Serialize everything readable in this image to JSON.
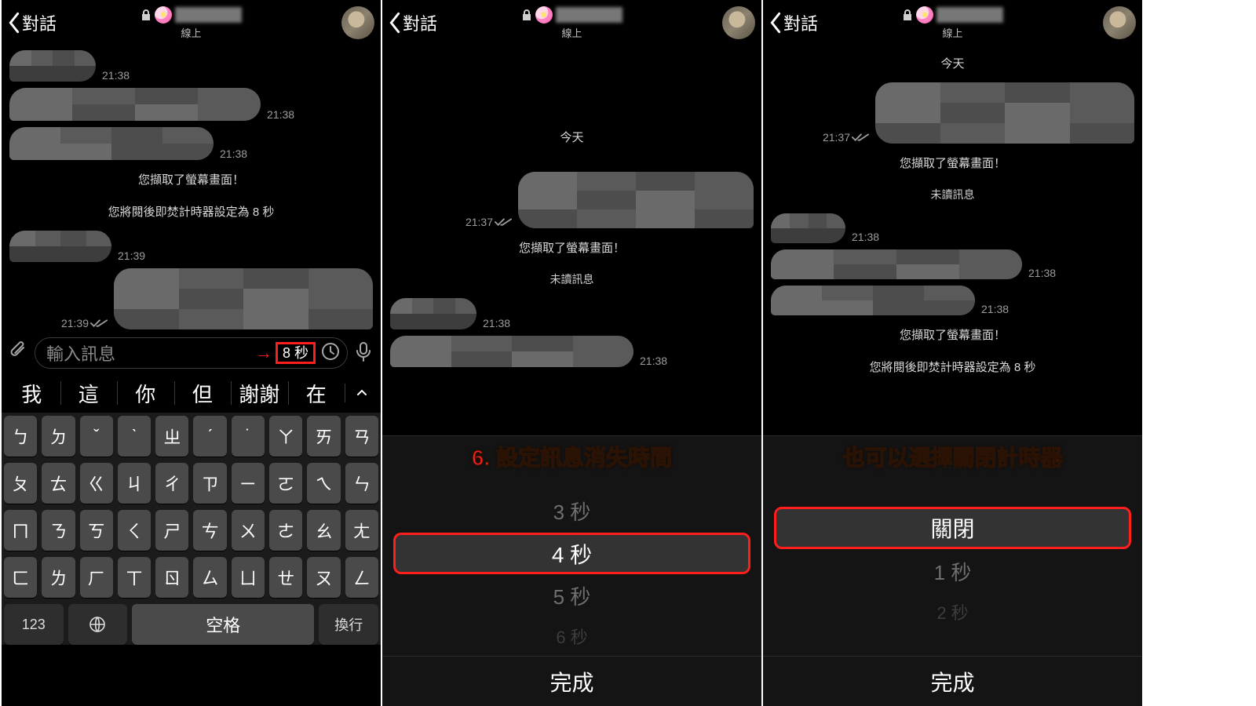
{
  "header": {
    "back_label": "對話",
    "status": "線上"
  },
  "pane1": {
    "msgs": {
      "t1": "21:38",
      "t2": "21:38",
      "t3": "21:38",
      "sys_screenshot": "您擷取了螢幕畫面！",
      "sys_timer": "您將閱後即焚計時器設定為 8 秒",
      "t4": "21:39",
      "t5": "21:39"
    },
    "input": {
      "placeholder": "輸入訊息",
      "timer_label": "8 秒"
    },
    "suggestions": [
      "我",
      "這",
      "你",
      "但",
      "謝謝",
      "在"
    ],
    "kbd": {
      "r1": [
        "ㄅ",
        "ㄉ",
        "ˇ",
        "ˋ",
        "ㄓ",
        "ˊ",
        "˙",
        "ㄚ",
        "ㄞ",
        "ㄢ"
      ],
      "r2": [
        "ㄆ",
        "ㄊ",
        "ㄍ",
        "ㄐ",
        "ㄔ",
        "ㄗ",
        "ㄧ",
        "ㄛ",
        "ㄟ",
        "ㄣ"
      ],
      "r3": [
        "ㄇ",
        "ㄋ",
        "ㄎ",
        "ㄑ",
        "ㄕ",
        "ㄘ",
        "ㄨ",
        "ㄜ",
        "ㄠ",
        "ㄤ"
      ],
      "r4": [
        "ㄈ",
        "ㄌ",
        "ㄏ",
        "ㄒ",
        "ㄖ",
        "ㄙ",
        "ㄩ",
        "ㄝ",
        "ㄡ",
        "ㄥ"
      ],
      "num": "123",
      "space": "空格",
      "enter": "換行"
    }
  },
  "pane2": {
    "day": "今天",
    "t1": "21:37",
    "sys_screenshot": "您擷取了螢幕畫面！",
    "unread": "未讀訊息",
    "t2": "21:38",
    "t3": "21:38",
    "annotation": "6. 設定訊息消失時間",
    "picker": {
      "above": "3 秒",
      "selected": "4 秒",
      "below": "5 秒",
      "faint": "6 秒",
      "done": "完成"
    }
  },
  "pane3": {
    "day": "今天",
    "t1": "21:37",
    "sys_screenshot": "您擷取了螢幕畫面！",
    "unread": "未讀訊息",
    "t2": "21:38",
    "t3": "21:38",
    "t4": "21:38",
    "sys_screenshot2": "您擷取了螢幕畫面！",
    "sys_timer": "您將閱後即焚計時器設定為 8 秒",
    "annotation": "也可以選擇關閉計時器",
    "picker": {
      "selected": "關閉",
      "below": "1 秒",
      "faint": "2 秒",
      "done": "完成"
    }
  }
}
